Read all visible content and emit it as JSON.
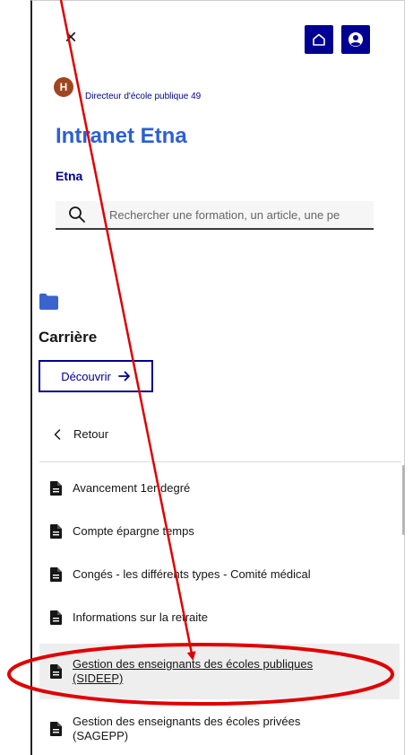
{
  "header": {
    "close_icon": "close-icon",
    "home_icon": "home-icon",
    "account_icon": "account-icon",
    "brand_color": "#000091"
  },
  "user": {
    "avatar_initial": "H",
    "avatar_color": "#a0451f",
    "role": "Directeur d'école publique 49"
  },
  "site": {
    "title": "Intranet Etna",
    "subtitle": "Etna"
  },
  "search": {
    "placeholder": "Rechercher une formation, un article, une pe",
    "icon": "search-icon"
  },
  "section": {
    "icon": "folder-icon",
    "title": "Carrière",
    "discover_label": "Découvrir",
    "discover_icon": "arrow-right-icon"
  },
  "nav": {
    "back_label": "Retour",
    "back_icon": "chevron-left-icon",
    "items": [
      {
        "label": "Avancement 1er degré",
        "icon": "document-icon"
      },
      {
        "label": "Compte épargne temps",
        "icon": "document-icon"
      },
      {
        "label": "Congés - les différents types - Comité médical",
        "icon": "document-icon"
      },
      {
        "label": "Informations sur la retraite",
        "icon": "document-icon"
      },
      {
        "label": "Gestion des enseignants des écoles publiques (SIDEEP)",
        "icon": "document-icon",
        "highlighted": true
      },
      {
        "label": "Gestion des enseignants des écoles privées (SAGEPP)",
        "icon": "document-icon"
      }
    ]
  },
  "annotation": {
    "color": "#e00000",
    "arrow": "red-arrow",
    "ellipse": "red-ellipse"
  }
}
